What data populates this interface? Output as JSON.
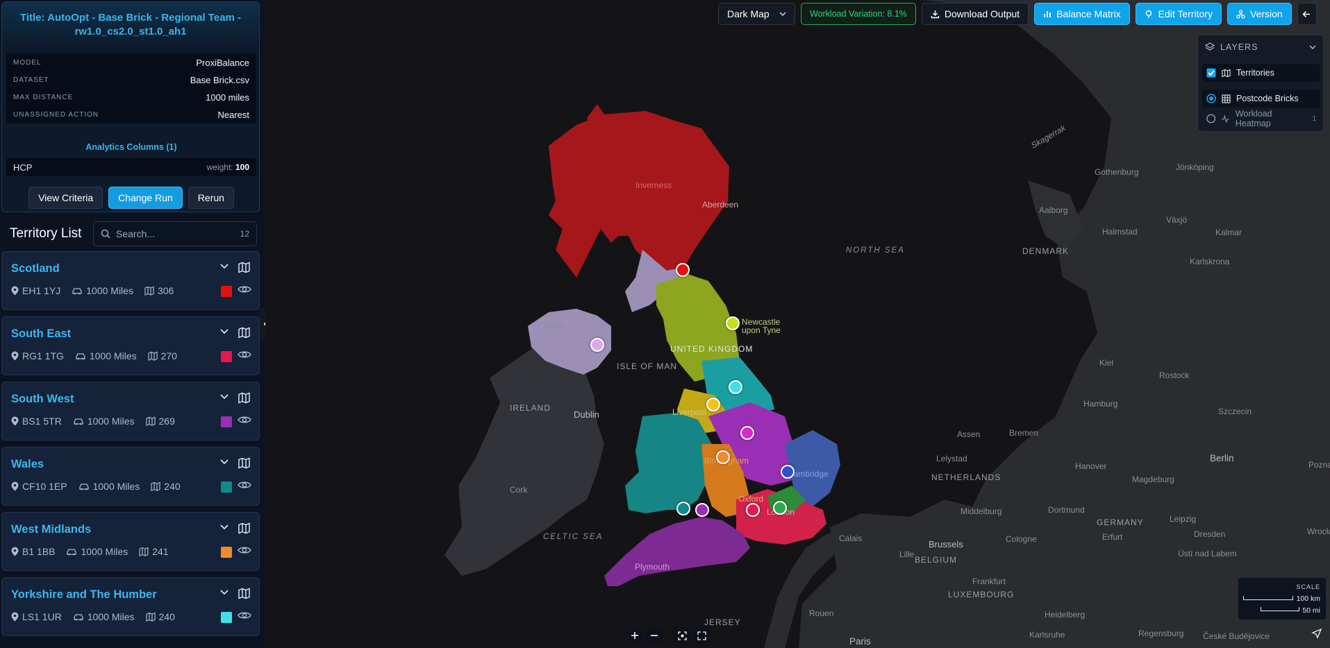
{
  "run": {
    "title": "Title: AutoOpt - Base Brick - Regional Team - rw1.0_cs2.0_st1.0_ah1",
    "params": [
      {
        "key": "MODEL",
        "value": "ProxiBalance"
      },
      {
        "key": "DATASET",
        "value": "Base Brick.csv"
      },
      {
        "key": "MAX DISTANCE",
        "value": "1000 miles"
      },
      {
        "key": "UNASSIGNED ACTION",
        "value": "Nearest"
      }
    ],
    "analytics_title": "Analytics Columns (1)",
    "analytics": [
      {
        "name": "HCP",
        "weight_label": "weight:",
        "weight": "100"
      }
    ],
    "buttons": {
      "view": "View Criteria",
      "change": "Change Run",
      "rerun": "Rerun"
    }
  },
  "territory_list": {
    "heading": "Territory List",
    "search_placeholder": "Search...",
    "count": "12",
    "items": [
      {
        "name": "Scotland",
        "postcode": "EH1 1YJ",
        "distance": "1000 Miles",
        "bricks": "306",
        "color": "#e60f0f"
      },
      {
        "name": "South East",
        "postcode": "RG1 1TG",
        "distance": "1000 Miles",
        "bricks": "270",
        "color": "#e8174f"
      },
      {
        "name": "South West",
        "postcode": "BS1 5TR",
        "distance": "1000 Miles",
        "bricks": "269",
        "color": "#9b2fb3"
      },
      {
        "name": "Wales",
        "postcode": "CF10 1EP",
        "distance": "1000 Miles",
        "bricks": "240",
        "color": "#0e8a8a"
      },
      {
        "name": "West Midlands",
        "postcode": "B1 1BB",
        "distance": "1000 Miles",
        "bricks": "241",
        "color": "#f08a2c"
      },
      {
        "name": "Yorkshire and The Humber",
        "postcode": "LS1 1UR",
        "distance": "1000 Miles",
        "bricks": "240",
        "color": "#3fe0e8"
      }
    ]
  },
  "toolbar": {
    "basemap": "Dark Map",
    "workload": "Workload Variation: 8.1%",
    "download": "Download Output",
    "balance": "Balance Matrix",
    "edit": "Edit Territory",
    "version": "Version"
  },
  "layers": {
    "title": "LAYERS",
    "items": [
      {
        "label": "Territories",
        "kind": "checkbox",
        "checked": true
      },
      {
        "label": "Postcode Bricks",
        "kind": "radio",
        "checked": true
      },
      {
        "label": "Workload Heatmap",
        "kind": "radio",
        "checked": false,
        "index": "1"
      }
    ]
  },
  "map_labels": {
    "north_sea": "NORTH SEA",
    "celtic_sea": "CELTIC SEA",
    "skagerrak": "Skagerrak",
    "uk": "UNITED KINGDOM",
    "isle_of_man": "ISLE OF MAN",
    "ireland": "IRELAND",
    "denmark": "DENMARK",
    "netherlands": "NETHERLANDS",
    "belgium": "BELGIUM",
    "germany": "GERMANY",
    "luxembourg": "LUXEMBOURG",
    "jersey": "JERSEY",
    "cities": [
      "Inverness",
      "Aberdeen",
      "Derry",
      "Newcastle upon Tyne",
      "Liverpool",
      "Dublin",
      "Cork",
      "Birmingham",
      "Oxford",
      "London",
      "Plymouth",
      "Cambridge",
      "Gothenburg",
      "Jönköping",
      "Aalborg",
      "Halmstad",
      "Växjö",
      "Kalmar",
      "Karlskrona",
      "Kiel",
      "Rostock",
      "Hamburg",
      "Szczecin",
      "Bremen",
      "Assen",
      "Lelystad",
      "Berlin",
      "Hanover",
      "Magdeburg",
      "Poznań",
      "Middelburg",
      "Dortmund",
      "Leipzig",
      "Brussels",
      "Cologne",
      "Erfurt",
      "Dresden",
      "Calais",
      "Lille",
      "Ústí nad Labem",
      "Wrocław",
      "Frankfurt",
      "Rouen",
      "Heidelberg",
      "Regensburg",
      "Karlsruhe",
      "České Budějovice",
      "Paris"
    ]
  },
  "scale": {
    "title": "SCALE",
    "km": "100 km",
    "mi": "50 mi"
  }
}
